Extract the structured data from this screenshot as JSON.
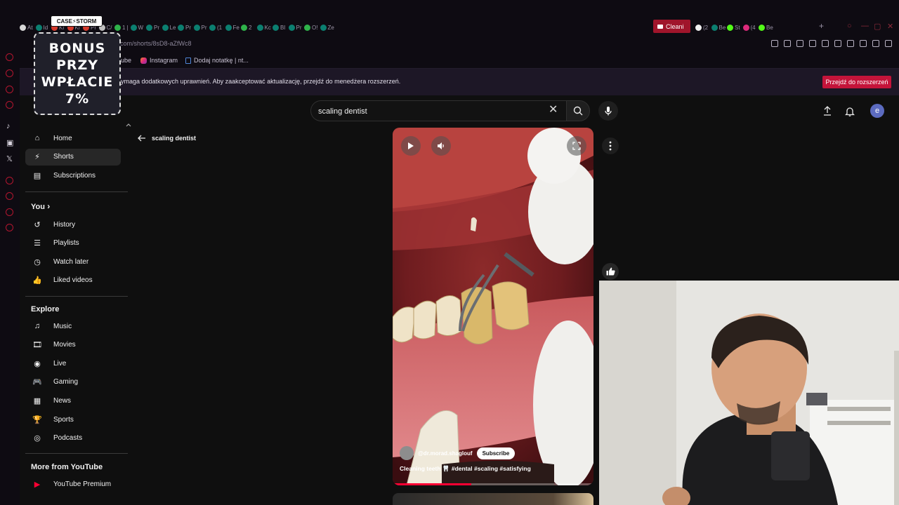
{
  "browser": {
    "tabs": [
      "At",
      "Id",
      "Ki",
      "Ki",
      "Pr",
      "C/",
      "1 |",
      "W",
      "Pr",
      "Le",
      "Pr",
      "Pr",
      "(1",
      "Fe",
      "2",
      "Kc",
      "Bl",
      "Pr",
      "O!",
      "Ze"
    ],
    "active_tab": "Cleani",
    "tabs_after": [
      "(2",
      "Be",
      "St",
      "(4",
      "Be"
    ],
    "url": "com/shorts/8sD8-aZfWc8",
    "bookmarks": [
      {
        "label": "ube"
      },
      {
        "label": "Instagram"
      },
      {
        "label": "Dodaj notatkę | nt..."
      }
    ],
    "notice_text": "ymaga dodatkowych uprawnień. Aby zaakceptować aktualizację, przejdź do menedżera rozszerzeń.",
    "notice_button": "Przejdź do rozszerzeń",
    "accent": "#c4143a"
  },
  "header": {
    "search_value": "scaling dentist",
    "avatar_letter": "e"
  },
  "sidebar": {
    "main": [
      {
        "label": "Home",
        "icon": "home-icon"
      },
      {
        "label": "Shorts",
        "icon": "shorts-icon",
        "active": true
      },
      {
        "label": "Subscriptions",
        "icon": "subscriptions-icon"
      }
    ],
    "you_heading": "You",
    "you": [
      {
        "label": "History",
        "icon": "history-icon"
      },
      {
        "label": "Playlists",
        "icon": "playlists-icon"
      },
      {
        "label": "Watch later",
        "icon": "watch-later-icon"
      },
      {
        "label": "Liked videos",
        "icon": "like-icon"
      }
    ],
    "explore_heading": "Explore",
    "explore": [
      {
        "label": "Music",
        "icon": "music-icon"
      },
      {
        "label": "Movies",
        "icon": "movies-icon"
      },
      {
        "label": "Live",
        "icon": "live-icon"
      },
      {
        "label": "Gaming",
        "icon": "gaming-icon"
      },
      {
        "label": "News",
        "icon": "news-icon"
      },
      {
        "label": "Sports",
        "icon": "sports-icon"
      },
      {
        "label": "Podcasts",
        "icon": "podcasts-icon"
      }
    ],
    "more_heading": "More from YouTube",
    "more": [
      {
        "label": "YouTube Premium",
        "icon": "youtube-premium-icon"
      }
    ]
  },
  "page": {
    "back_label": "scaling dentist"
  },
  "short": {
    "channel": "@dr.morad.shaglouf",
    "subscribe": "Subscribe",
    "caption": "Cleaning teeth 🦷 #dental #scaling #satisfying",
    "progress": 0.39
  },
  "overlay": {
    "badge": "CASE⚡STORM",
    "promo_lines": [
      "BONUS",
      "PRZY",
      "WPŁACIE",
      "7%"
    ]
  }
}
